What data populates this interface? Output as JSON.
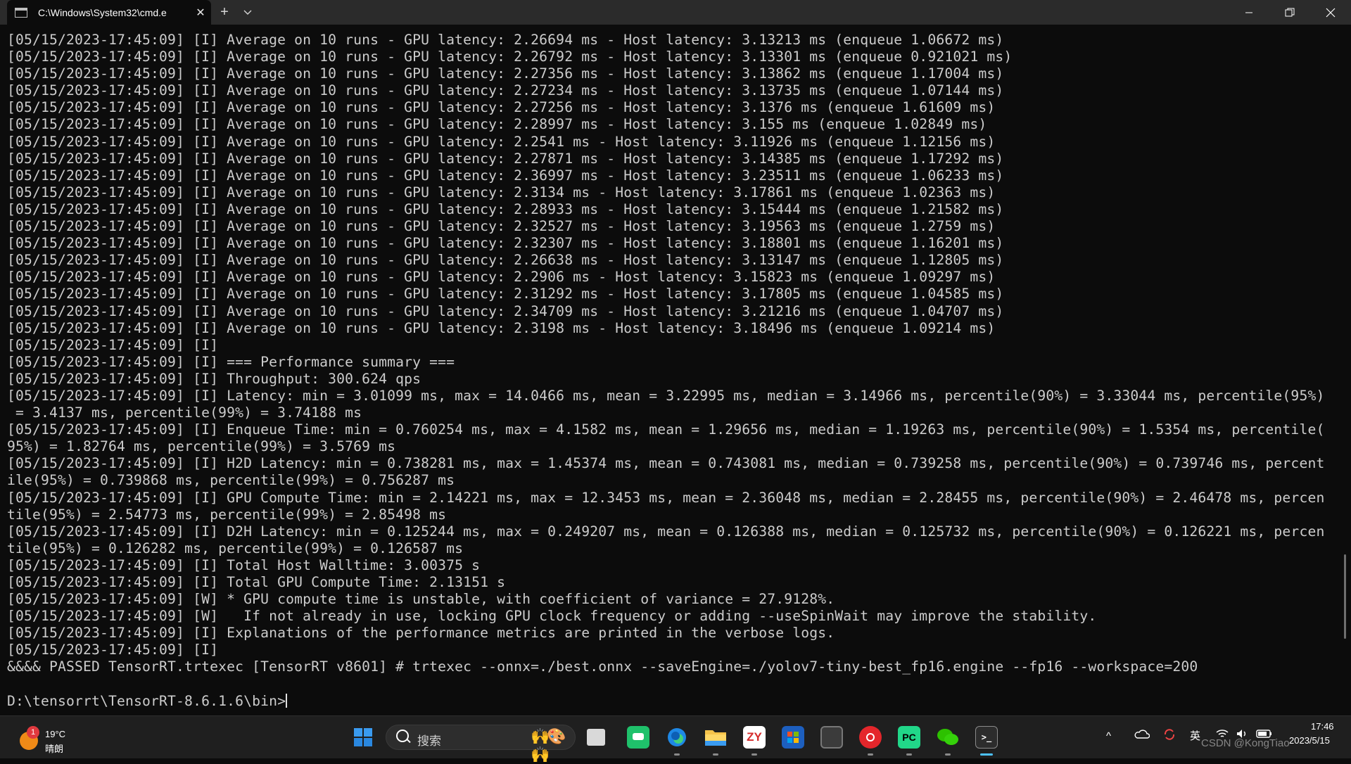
{
  "window": {
    "tab_title": "C:\\Windows\\System32\\cmd.e",
    "tab_close": "✕",
    "new_tab": "+",
    "dropdown": "⌄",
    "icons": [
      "cmd-icon",
      "close-icon",
      "plus-icon",
      "chevron-down-icon",
      "minimize-icon",
      "maximize-icon",
      "close-window-icon"
    ]
  },
  "console": {
    "lines": [
      "[05/15/2023-17:45:09] [I] Average on 10 runs - GPU latency: 2.26694 ms - Host latency: 3.13213 ms (enqueue 1.06672 ms)",
      "[05/15/2023-17:45:09] [I] Average on 10 runs - GPU latency: 2.26792 ms - Host latency: 3.13301 ms (enqueue 0.921021 ms)",
      "[05/15/2023-17:45:09] [I] Average on 10 runs - GPU latency: 2.27356 ms - Host latency: 3.13862 ms (enqueue 1.17004 ms)",
      "[05/15/2023-17:45:09] [I] Average on 10 runs - GPU latency: 2.27234 ms - Host latency: 3.13735 ms (enqueue 1.07144 ms)",
      "[05/15/2023-17:45:09] [I] Average on 10 runs - GPU latency: 2.27256 ms - Host latency: 3.1376 ms (enqueue 1.61609 ms)",
      "[05/15/2023-17:45:09] [I] Average on 10 runs - GPU latency: 2.28997 ms - Host latency: 3.155 ms (enqueue 1.02849 ms)",
      "[05/15/2023-17:45:09] [I] Average on 10 runs - GPU latency: 2.2541 ms - Host latency: 3.11926 ms (enqueue 1.12156 ms)",
      "[05/15/2023-17:45:09] [I] Average on 10 runs - GPU latency: 2.27871 ms - Host latency: 3.14385 ms (enqueue 1.17292 ms)",
      "[05/15/2023-17:45:09] [I] Average on 10 runs - GPU latency: 2.36997 ms - Host latency: 3.23511 ms (enqueue 1.06233 ms)",
      "[05/15/2023-17:45:09] [I] Average on 10 runs - GPU latency: 2.3134 ms - Host latency: 3.17861 ms (enqueue 1.02363 ms)",
      "[05/15/2023-17:45:09] [I] Average on 10 runs - GPU latency: 2.28933 ms - Host latency: 3.15444 ms (enqueue 1.21582 ms)",
      "[05/15/2023-17:45:09] [I] Average on 10 runs - GPU latency: 2.32527 ms - Host latency: 3.19563 ms (enqueue 1.2759 ms)",
      "[05/15/2023-17:45:09] [I] Average on 10 runs - GPU latency: 2.32307 ms - Host latency: 3.18801 ms (enqueue 1.16201 ms)",
      "[05/15/2023-17:45:09] [I] Average on 10 runs - GPU latency: 2.26638 ms - Host latency: 3.13147 ms (enqueue 1.12805 ms)",
      "[05/15/2023-17:45:09] [I] Average on 10 runs - GPU latency: 2.2906 ms - Host latency: 3.15823 ms (enqueue 1.09297 ms)",
      "[05/15/2023-17:45:09] [I] Average on 10 runs - GPU latency: 2.31292 ms - Host latency: 3.17805 ms (enqueue 1.04585 ms)",
      "[05/15/2023-17:45:09] [I] Average on 10 runs - GPU latency: 2.34709 ms - Host latency: 3.21216 ms (enqueue 1.04707 ms)",
      "[05/15/2023-17:45:09] [I] Average on 10 runs - GPU latency: 2.3198 ms - Host latency: 3.18496 ms (enqueue 1.09214 ms)",
      "[05/15/2023-17:45:09] [I]",
      "[05/15/2023-17:45:09] [I] === Performance summary ===",
      "[05/15/2023-17:45:09] [I] Throughput: 300.624 qps",
      "[05/15/2023-17:45:09] [I] Latency: min = 3.01099 ms, max = 14.0466 ms, mean = 3.22995 ms, median = 3.14966 ms, percentile(90%) = 3.33044 ms, percentile(95%)",
      " = 3.4137 ms, percentile(99%) = 3.74188 ms",
      "[05/15/2023-17:45:09] [I] Enqueue Time: min = 0.760254 ms, max = 4.1582 ms, mean = 1.29656 ms, median = 1.19263 ms, percentile(90%) = 1.5354 ms, percentile(",
      "95%) = 1.82764 ms, percentile(99%) = 3.5769 ms",
      "[05/15/2023-17:45:09] [I] H2D Latency: min = 0.738281 ms, max = 1.45374 ms, mean = 0.743081 ms, median = 0.739258 ms, percentile(90%) = 0.739746 ms, percent",
      "ile(95%) = 0.739868 ms, percentile(99%) = 0.756287 ms",
      "[05/15/2023-17:45:09] [I] GPU Compute Time: min = 2.14221 ms, max = 12.3453 ms, mean = 2.36048 ms, median = 2.28455 ms, percentile(90%) = 2.46478 ms, percen",
      "tile(95%) = 2.54773 ms, percentile(99%) = 2.85498 ms",
      "[05/15/2023-17:45:09] [I] D2H Latency: min = 0.125244 ms, max = 0.249207 ms, mean = 0.126388 ms, median = 0.125732 ms, percentile(90%) = 0.126221 ms, percen",
      "tile(95%) = 0.126282 ms, percentile(99%) = 0.126587 ms",
      "[05/15/2023-17:45:09] [I] Total Host Walltime: 3.00375 s",
      "[05/15/2023-17:45:09] [I] Total GPU Compute Time: 2.13151 s",
      "[05/15/2023-17:45:09] [W] * GPU compute time is unstable, with coefficient of variance = 27.9128%.",
      "[05/15/2023-17:45:09] [W]   If not already in use, locking GPU clock frequency or adding --useSpinWait may improve the stability.",
      "[05/15/2023-17:45:09] [I] Explanations of the performance metrics are printed in the verbose logs.",
      "[05/15/2023-17:45:09] [I]",
      "&&&& PASSED TensorRT.trtexec [TensorRT v8601] # trtexec --onnx=./best.onnx --saveEngine=./yolov7-tiny-best_fp16.engine --fp16 --workspace=200",
      ""
    ],
    "prompt": "D:\\tensorrt\\TensorRT-8.6.1.6\\bin>"
  },
  "taskbar": {
    "weather": {
      "badge": "1",
      "temp": "19°C",
      "condition": "晴朗",
      "icon": "sun-icon"
    },
    "search": {
      "placeholder": "搜索",
      "art": "🙌🎨🙌"
    },
    "apps": [
      {
        "name": "start-icon",
        "label": ""
      },
      {
        "name": "task-view-icon",
        "label": ""
      },
      {
        "name": "wechat-work-icon",
        "label": ""
      },
      {
        "name": "edge-icon",
        "label": ""
      },
      {
        "name": "file-explorer-icon",
        "label": ""
      },
      {
        "name": "zy-app-icon",
        "label": "ZY"
      },
      {
        "name": "store-icon",
        "label": ""
      },
      {
        "name": "terminal-gray-icon",
        "label": ""
      },
      {
        "name": "netease-music-icon",
        "label": ""
      },
      {
        "name": "pycharm-icon",
        "label": "PC"
      },
      {
        "name": "wechat-icon",
        "label": ""
      },
      {
        "name": "terminal-icon",
        "label": ">_"
      }
    ],
    "tray": {
      "chevron": "^",
      "ime": "英",
      "icons": [
        "onedrive-icon",
        "sync-icon",
        "wifi-icon",
        "volume-icon",
        "battery-icon"
      ]
    },
    "clock": {
      "time": "17:46",
      "date": "2023/5/15"
    },
    "watermark": "CSDN @KongTiao"
  },
  "colors": {
    "console_bg": "#0c0c0c",
    "console_text": "#cccccc",
    "titlebar_bg": "#2b2b2b",
    "taskbar_bg": "#1f1f1f",
    "active_indicator": "#4cc2ff"
  }
}
